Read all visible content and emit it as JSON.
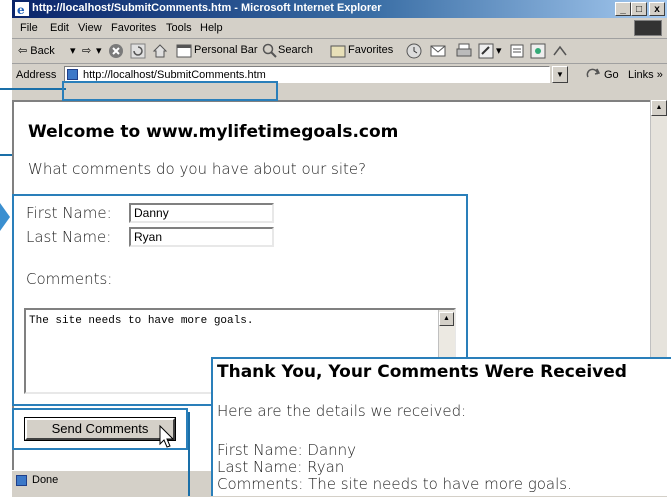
{
  "window": {
    "title": "http://localhost/SubmitComments.htm - Microsoft Internet Explorer",
    "controls": {
      "minimize": "_",
      "maximize": "□",
      "close": "x"
    }
  },
  "menu": [
    "File",
    "Edit",
    "View",
    "Favorites",
    "Tools",
    "Help"
  ],
  "toolbar": {
    "back": "⇦ Back",
    "back_arrow": "▾",
    "forward": "⇨",
    "forward_arrow": "▾",
    "personal_bar": "Personal Bar",
    "search": "Search",
    "favorites": "Favorites"
  },
  "address": {
    "label": "Address",
    "url": "http://localhost/SubmitComments.htm",
    "go": "Go",
    "links": "Links »"
  },
  "page": {
    "heading": "Welcome to www.mylifetimegoals.com",
    "question": "What comments do you have about our site?",
    "first_name_label": "First Name:",
    "first_name_value": "Danny",
    "last_name_label": "Last Name:",
    "last_name_value": "Ryan",
    "comments_label": "Comments:",
    "comments_value": "The site needs to have more goals.",
    "submit_label": "Send Comments"
  },
  "status": {
    "text": "Done"
  },
  "result": {
    "title": "Thank You, Your Comments Were Received",
    "intro": "Here are the details we received:",
    "first_name_line": "First Name: Danny",
    "last_name_line": "Last Name: Ryan",
    "comments_line": "Comments: The site needs to have more goals."
  }
}
